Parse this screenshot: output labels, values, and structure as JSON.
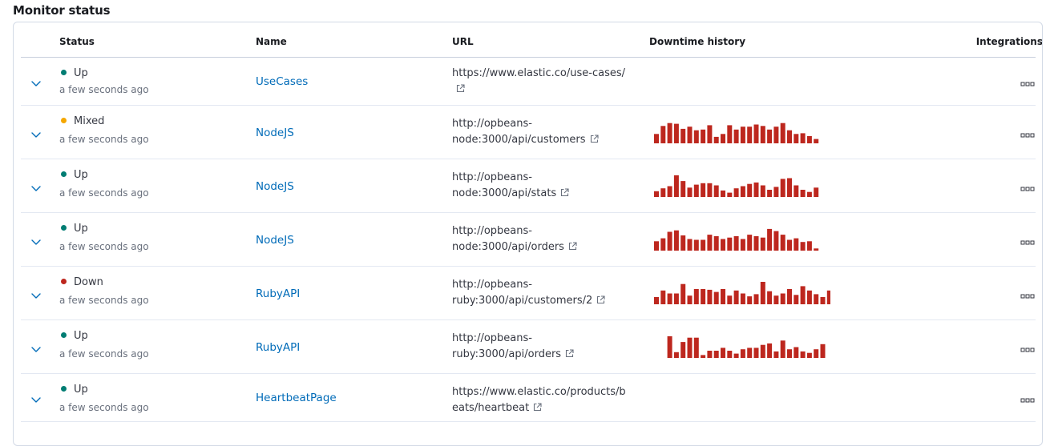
{
  "page": {
    "title": "Monitor status"
  },
  "table": {
    "columns": {
      "status": "Status",
      "name": "Name",
      "url": "URL",
      "history": "Downtime history",
      "integrations": "Integrations"
    },
    "rows": [
      {
        "status": "Up",
        "status_color": "#017d73",
        "time": "a few seconds ago",
        "name": "UseCases",
        "url_line1": "https://www.elastic.co/use-cases/",
        "url_line2": "",
        "history": []
      },
      {
        "status": "Mixed",
        "status_color": "#f5a700",
        "time": "a few seconds ago",
        "name": "NodeJS",
        "url_line1": "http://opbeans-",
        "url_line2": "node:3000/api/customers",
        "history": [
          13,
          24,
          28,
          27,
          20,
          23,
          18,
          19,
          25,
          9,
          13,
          25,
          19,
          23,
          23,
          26,
          24,
          19,
          23,
          28,
          18,
          13,
          14,
          10,
          6
        ]
      },
      {
        "status": "Up",
        "status_color": "#017d73",
        "time": "a few seconds ago",
        "name": "NodeJS",
        "url_line1": "http://opbeans-",
        "url_line2": "node:3000/api/stats",
        "history": [
          8,
          12,
          15,
          30,
          22,
          13,
          17,
          19,
          19,
          16,
          9,
          6,
          12,
          15,
          18,
          20,
          16,
          10,
          14,
          25,
          26,
          16,
          10,
          7,
          13
        ]
      },
      {
        "status": "Up",
        "status_color": "#017d73",
        "time": "a few seconds ago",
        "name": "NodeJS",
        "url_line1": "http://opbeans-",
        "url_line2": "node:3000/api/orders",
        "history": [
          13,
          17,
          26,
          28,
          21,
          16,
          15,
          15,
          22,
          20,
          16,
          18,
          20,
          16,
          22,
          20,
          18,
          30,
          27,
          22,
          15,
          17,
          12,
          13,
          3
        ]
      },
      {
        "status": "Down",
        "status_color": "#bd271e",
        "time": "a few seconds ago",
        "name": "RubyAPI",
        "url_line1": "http://opbeans-",
        "url_line2": "ruby:3000/api/customers/2",
        "history": [
          10,
          19,
          15,
          15,
          28,
          12,
          21,
          21,
          20,
          17,
          21,
          12,
          19,
          15,
          11,
          14,
          31,
          18,
          12,
          15,
          21,
          13,
          25,
          19,
          14,
          10,
          19,
          10
        ]
      },
      {
        "status": "Up",
        "status_color": "#017d73",
        "time": "a few seconds ago",
        "name": "RubyAPI",
        "url_line1": "http://opbeans-",
        "url_line2": "ruby:3000/api/orders",
        "history": [
          0,
          0,
          30,
          8,
          22,
          28,
          28,
          4,
          10,
          10,
          14,
          10,
          6,
          12,
          14,
          14,
          18,
          20,
          9,
          24,
          12,
          15,
          9,
          7,
          12,
          19
        ]
      },
      {
        "status": "Up",
        "status_color": "#017d73",
        "time": "a few seconds ago",
        "name": "HeartbeatPage",
        "url_line1": "https://www.elastic.co/products/b",
        "url_line2": "eats/heartbeat",
        "history": []
      }
    ]
  },
  "colors": {
    "link": "#006bb8",
    "bar": "#bd271e",
    "border": "#d3dae6"
  },
  "icons": {
    "expand": "chevron-down-icon",
    "external": "external-link-icon",
    "actions": "more-actions-icon"
  }
}
